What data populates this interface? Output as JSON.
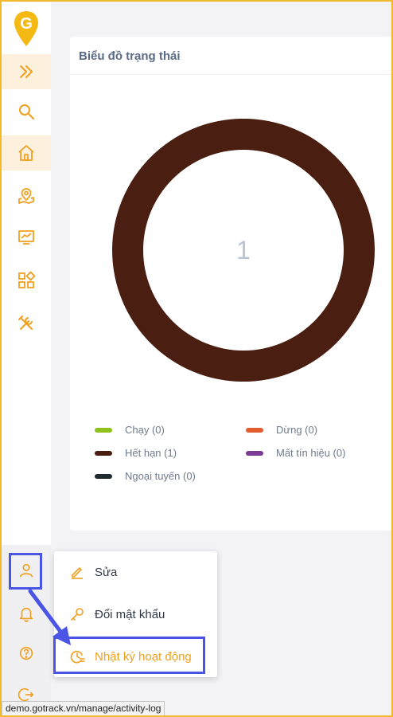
{
  "brand": {
    "logo_letter": "G"
  },
  "sidebar": {
    "items": [
      {
        "icon": "chevrons-right-icon",
        "active": true
      },
      {
        "icon": "search-icon",
        "active": false
      },
      {
        "icon": "home-icon",
        "active": true
      },
      {
        "icon": "map-pin-icon",
        "active": false
      },
      {
        "icon": "monitor-chart-icon",
        "active": false
      },
      {
        "icon": "apps-icon",
        "active": false
      },
      {
        "icon": "tools-icon",
        "active": false
      }
    ],
    "bottom_items": [
      {
        "icon": "user-icon"
      },
      {
        "icon": "bell-icon"
      },
      {
        "icon": "help-icon"
      },
      {
        "icon": "logout-icon"
      }
    ]
  },
  "card": {
    "title": "Biểu đồ trạng thái"
  },
  "chart_data": {
    "type": "pie",
    "center_label": "1",
    "slices": [
      {
        "name": "Chạy (0)",
        "value": 0,
        "color": "#8dc21f"
      },
      {
        "name": "Dừng (0)",
        "value": 0,
        "color": "#e35d2e"
      },
      {
        "name": "Hết hạn (1)",
        "value": 1,
        "color": "#4a1e10"
      },
      {
        "name": "Mất tín hiệu (0)",
        "value": 0,
        "color": "#7b3a94"
      },
      {
        "name": "Ngoại tuyến (0)",
        "value": 0,
        "color": "#1f2b30"
      }
    ]
  },
  "legend": {
    "running": "Chạy (0)",
    "stopped": "Dừng (0)",
    "expired": "Hết hạn (1)",
    "lost_signal": "Mất tín hiệu (0)",
    "offline": "Ngoại tuyến (0)"
  },
  "user_menu": {
    "edit": "Sửa",
    "change_password": "Đổi mật khẩu",
    "activity_log": "Nhật ký hoạt động"
  },
  "status_bar": {
    "url": "demo.gotrack.vn/manage/activity-log"
  },
  "colors": {
    "accent": "#f0a020",
    "annotation": "#4a55e6",
    "frame": "#f2b92b"
  }
}
